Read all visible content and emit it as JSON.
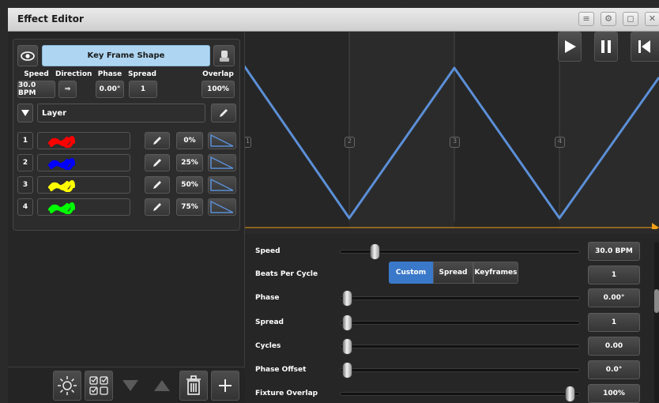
{
  "window": {
    "title": "Effect Editor"
  },
  "header": {
    "shape_name": "Key Frame Shape",
    "params": [
      {
        "label": "Speed",
        "value": "30.0 BPM"
      },
      {
        "label": "Direction",
        "value": "⇒"
      },
      {
        "label": "Phase",
        "value": "0.00°"
      },
      {
        "label": "Spread",
        "value": "1"
      },
      {
        "label": "Overlap",
        "value": "100%"
      }
    ]
  },
  "layer": {
    "label": "Layer"
  },
  "rows": [
    {
      "num": "1",
      "color": "#ff0000",
      "phase": "0%"
    },
    {
      "num": "2",
      "color": "#0000ff",
      "phase": "25%"
    },
    {
      "num": "3",
      "color": "#ffff00",
      "phase": "50%"
    },
    {
      "num": "4",
      "color": "#00ff00",
      "phase": "75%"
    }
  ],
  "graph": {
    "markers": [
      "1",
      "2",
      "3",
      "4"
    ],
    "line_color": "#5b8fd6",
    "playhead_color": "#f0a018"
  },
  "controls": {
    "speed": {
      "label": "Speed",
      "value": "30.0 BPM",
      "slider": 0.12
    },
    "beats_per_cycle": {
      "label": "Beats Per Cycle",
      "options": [
        "Custom",
        "Spread",
        "Keyframes"
      ],
      "selected": "Custom",
      "value": "1"
    },
    "phase": {
      "label": "Phase",
      "value": "0.00°",
      "slider": 0.0
    },
    "spread": {
      "label": "Spread",
      "value": "1",
      "slider": 0.0
    },
    "cycles": {
      "label": "Cycles",
      "value": "0.00",
      "slider": 0.0
    },
    "phase_offset": {
      "label": "Phase Offset",
      "value": "0.0°",
      "slider": 0.0
    },
    "fixture_overlap": {
      "label": "Fixture Overlap",
      "value": "100%",
      "slider": 0.97
    }
  },
  "colors": {
    "accent": "#3a78c9",
    "selected_bg": "#aed6f2"
  }
}
